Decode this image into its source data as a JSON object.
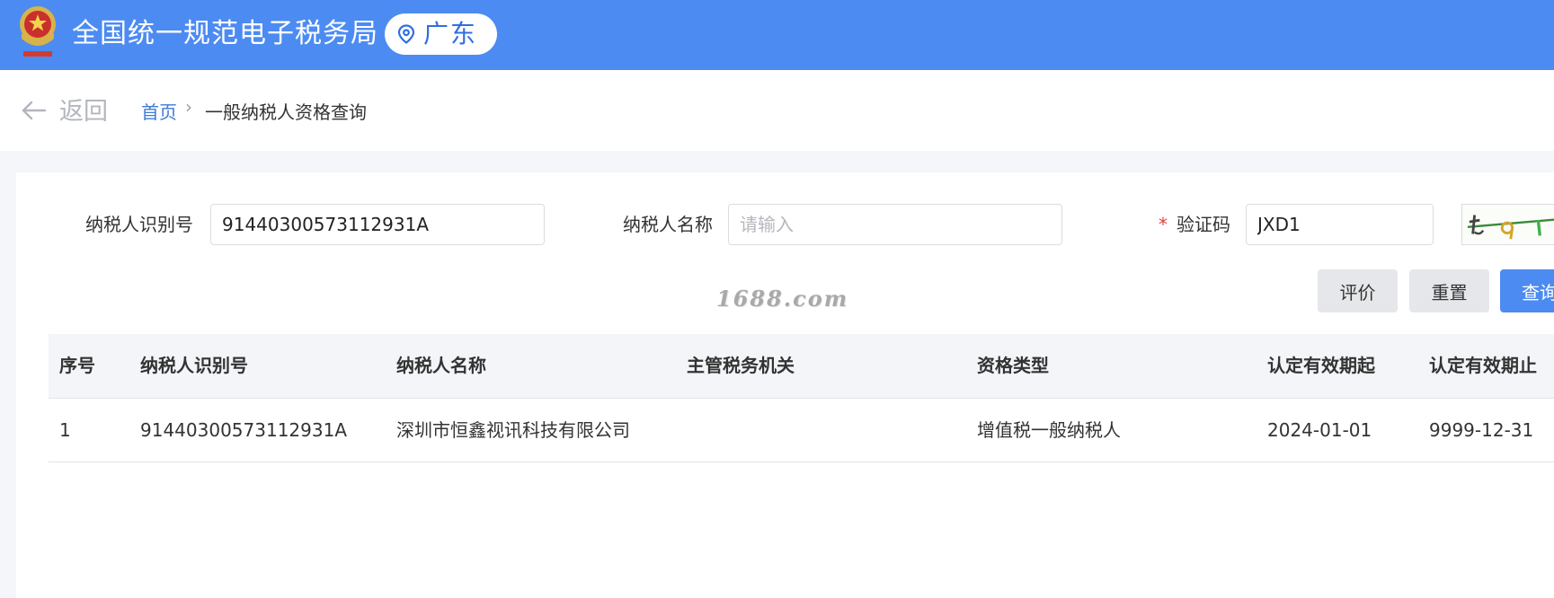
{
  "header": {
    "emblem_icon": "national-tax-emblem",
    "title": "全国统一规范电子税务局",
    "region_icon": "location-pin-icon",
    "region": "广东",
    "accent_color": "#4c8bf2"
  },
  "breadcrumb": {
    "back_icon": "arrow-left-icon",
    "back_label": "返回",
    "home": "首页",
    "separator": "›",
    "current": "一般纳税人资格查询"
  },
  "form": {
    "taxpayer_id": {
      "label": "纳税人识别号",
      "value": "91440300573112931A"
    },
    "taxpayer_name": {
      "label": "纳税人名称",
      "value": "",
      "placeholder": "请输入"
    },
    "captcha": {
      "required_mark": "*",
      "label": "验证码",
      "value": "JXD1"
    }
  },
  "buttons": {
    "evaluate": "评价",
    "reset": "重置",
    "query": "查询"
  },
  "watermark": "1688.com",
  "table": {
    "columns": [
      "序号",
      "纳税人识别号",
      "纳税人名称",
      "主管税务机关",
      "资格类型",
      "认定有效期起",
      "认定有效期止"
    ],
    "rows": [
      [
        "1",
        "91440300573112931A",
        "深圳市恒鑫视讯科技有限公司",
        "",
        "增值税一般纳税人",
        "2024-01-01",
        "9999-12-31"
      ]
    ]
  }
}
